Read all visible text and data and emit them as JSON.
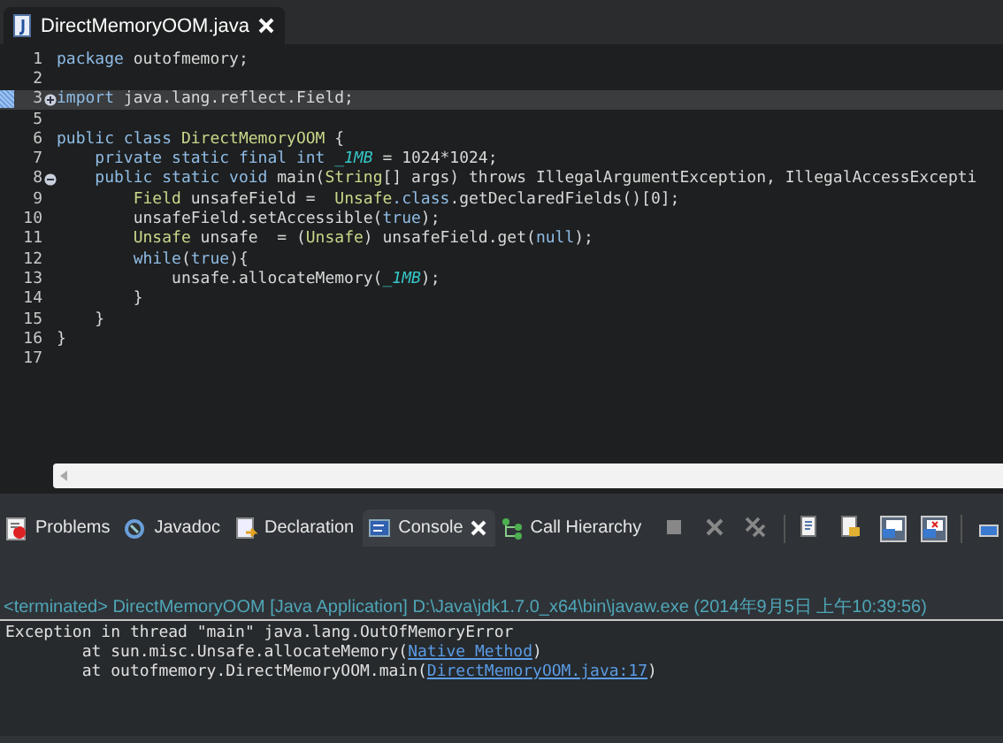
{
  "editor": {
    "tab": {
      "title": "DirectMemoryOOM.java",
      "selected": true
    },
    "lines": [
      {
        "number": "1",
        "current": false,
        "tokens": [
          {
            "kind": "keyword",
            "text": "package"
          },
          {
            "kind": "plain",
            "text": " outofmemory;"
          }
        ]
      },
      {
        "number": "2",
        "current": false
      },
      {
        "number": "3",
        "current": true,
        "fold": {
          "collapsed": true
        },
        "tokens": [
          {
            "kind": "keyword",
            "text": "import"
          },
          {
            "kind": "plain",
            "text": " java.lang.reflect.Field;"
          }
        ]
      },
      {
        "number": "5",
        "current": false
      },
      {
        "number": "6",
        "current": false,
        "tokens": [
          {
            "kind": "keyword",
            "text": "public class "
          },
          {
            "kind": "type",
            "text": "DirectMemoryOOM"
          },
          {
            "kind": "plain",
            "text": " {"
          }
        ]
      },
      {
        "number": "7",
        "current": false,
        "tokens": [
          {
            "kind": "keyword",
            "text": "    private static final int "
          },
          {
            "kind": "constant",
            "text": "_1MB"
          },
          {
            "kind": "plain",
            "text": " = 1024*1024;"
          }
        ]
      },
      {
        "number": "8",
        "current": false,
        "fold": {
          "collapsed": false
        },
        "tokens": [
          {
            "kind": "keyword",
            "text": "    public static void"
          },
          {
            "kind": "plain",
            "text": " main("
          },
          {
            "kind": "type",
            "text": "String"
          },
          {
            "kind": "plain",
            "text": "[] args) throws IllegalArgumentException, IllegalAccessExcepti"
          }
        ]
      },
      {
        "number": "9",
        "current": false,
        "tokens": [
          {
            "kind": "type",
            "text": "        Field"
          },
          {
            "kind": "plain",
            "text": " unsafeField =  "
          },
          {
            "kind": "type",
            "text": "Unsafe"
          },
          {
            "kind": "keyword",
            "text": ".class"
          },
          {
            "kind": "plain",
            "text": ".getDeclaredFields()[0];"
          }
        ]
      },
      {
        "number": "10",
        "current": false,
        "tokens": [
          {
            "kind": "plain",
            "text": "        unsafeField.setAccessible("
          },
          {
            "kind": "keyword",
            "text": "true"
          },
          {
            "kind": "plain",
            "text": ");"
          }
        ]
      },
      {
        "number": "11",
        "current": false,
        "tokens": [
          {
            "kind": "type",
            "text": "        Unsafe"
          },
          {
            "kind": "plain",
            "text": " unsafe  = ("
          },
          {
            "kind": "type",
            "text": "Unsafe"
          },
          {
            "kind": "plain",
            "text": ") unsafeField.get("
          },
          {
            "kind": "keyword",
            "text": "null"
          },
          {
            "kind": "plain",
            "text": ");"
          }
        ]
      },
      {
        "number": "12",
        "current": false,
        "tokens": [
          {
            "kind": "keyword",
            "text": "        while"
          },
          {
            "kind": "plain",
            "text": "("
          },
          {
            "kind": "keyword",
            "text": "true"
          },
          {
            "kind": "plain",
            "text": "){"
          }
        ]
      },
      {
        "number": "13",
        "current": false,
        "tokens": [
          {
            "kind": "plain",
            "text": "            unsafe.allocateMemory("
          },
          {
            "kind": "constant",
            "text": "_1MB"
          },
          {
            "kind": "plain",
            "text": ");"
          }
        ]
      },
      {
        "number": "14",
        "current": false,
        "tokens": [
          {
            "kind": "plain",
            "text": "        }"
          }
        ]
      },
      {
        "number": "15",
        "current": false,
        "tokens": [
          {
            "kind": "plain",
            "text": "    }"
          }
        ]
      },
      {
        "number": "16",
        "current": false,
        "tokens": [
          {
            "kind": "plain",
            "text": "}"
          }
        ]
      },
      {
        "number": "17",
        "current": false
      }
    ]
  },
  "views": {
    "tabs": [
      {
        "label": "Problems",
        "selected": false
      },
      {
        "label": "Javadoc",
        "selected": false
      },
      {
        "label": "Declaration",
        "selected": false
      },
      {
        "label": "Console",
        "selected": true
      },
      {
        "label": "Call Hierarchy",
        "selected": false
      }
    ]
  },
  "console": {
    "header": "<terminated> DirectMemoryOOM [Java Application] D:\\Java\\jdk1.7.0_x64\\bin\\javaw.exe (2014年9月5日 上午10:39:56)",
    "lines": [
      [
        {
          "kind": "plain",
          "text": "Exception in thread \"main\" java.lang.OutOfMemoryError"
        }
      ],
      [
        {
          "kind": "plain",
          "text": "        at sun.misc.Unsafe.allocateMemory("
        },
        {
          "kind": "link",
          "text": "Native Method"
        },
        {
          "kind": "plain",
          "text": ")"
        }
      ],
      [
        {
          "kind": "plain",
          "text": "        at outofmemory.DirectMemoryOOM.main("
        },
        {
          "kind": "link",
          "text": "DirectMemoryOOM.java:17"
        },
        {
          "kind": "plain",
          "text": ")"
        }
      ]
    ]
  }
}
